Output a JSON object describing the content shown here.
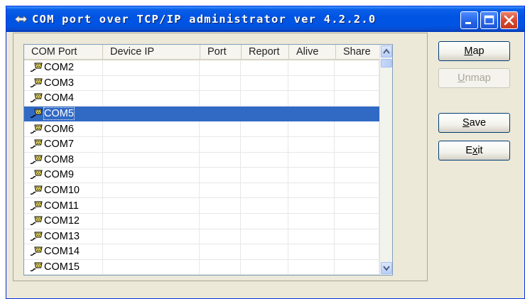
{
  "window": {
    "title": "COM port over TCP/IP administrator ver 4.2.2.0"
  },
  "table": {
    "columns": [
      "COM Port",
      "Device IP",
      "Port",
      "Report",
      "Alive",
      "Share"
    ],
    "rows": [
      {
        "port": "COM2"
      },
      {
        "port": "COM3"
      },
      {
        "port": "COM4"
      },
      {
        "port": "COM5",
        "selected": true
      },
      {
        "port": "COM6"
      },
      {
        "port": "COM7"
      },
      {
        "port": "COM8"
      },
      {
        "port": "COM9"
      },
      {
        "port": "COM10"
      },
      {
        "port": "COM11"
      },
      {
        "port": "COM12"
      },
      {
        "port": "COM13"
      },
      {
        "port": "COM14"
      },
      {
        "port": "COM15"
      }
    ]
  },
  "buttons": {
    "map": {
      "mnemonic": "M",
      "rest": "ap"
    },
    "unmap": {
      "mnemonic": "U",
      "rest": "nmap",
      "disabled": true
    },
    "save": {
      "mnemonic": "S",
      "rest": "ave"
    },
    "exit": {
      "first": "E",
      "mnemonic": "x",
      "rest": "it"
    }
  },
  "colors": {
    "selection": "#316ac5",
    "titlebar": "#0054e3",
    "face": "#ece9d8"
  },
  "icons": [
    "app-icon",
    "minimize-icon",
    "maximize-icon",
    "close-icon",
    "com-port-icon",
    "scroll-up-icon",
    "scroll-down-icon"
  ]
}
